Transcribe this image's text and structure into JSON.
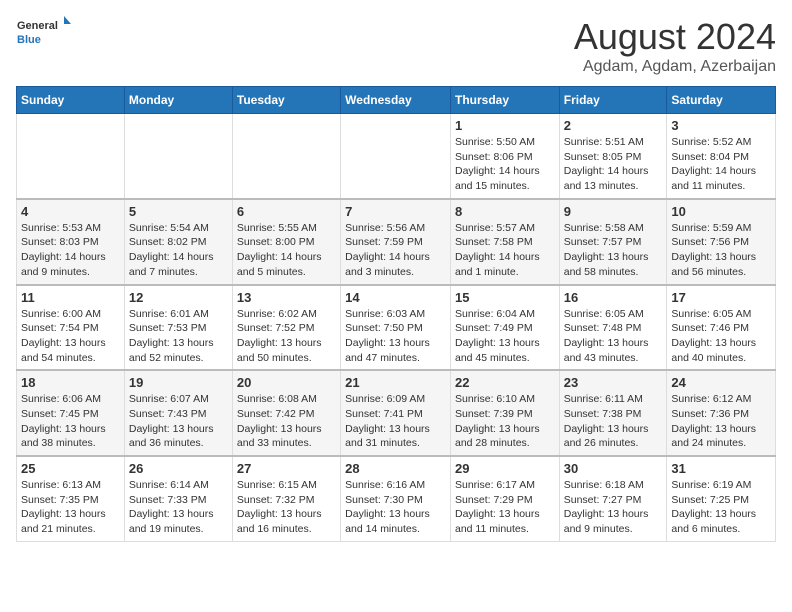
{
  "header": {
    "logo_general": "General",
    "logo_blue": "Blue",
    "month_year": "August 2024",
    "location": "Agdam, Agdam, Azerbaijan"
  },
  "weekdays": [
    "Sunday",
    "Monday",
    "Tuesday",
    "Wednesday",
    "Thursday",
    "Friday",
    "Saturday"
  ],
  "weeks": [
    [
      {
        "day": "",
        "detail": ""
      },
      {
        "day": "",
        "detail": ""
      },
      {
        "day": "",
        "detail": ""
      },
      {
        "day": "",
        "detail": ""
      },
      {
        "day": "1",
        "detail": "Sunrise: 5:50 AM\nSunset: 8:06 PM\nDaylight: 14 hours and 15 minutes."
      },
      {
        "day": "2",
        "detail": "Sunrise: 5:51 AM\nSunset: 8:05 PM\nDaylight: 14 hours and 13 minutes."
      },
      {
        "day": "3",
        "detail": "Sunrise: 5:52 AM\nSunset: 8:04 PM\nDaylight: 14 hours and 11 minutes."
      }
    ],
    [
      {
        "day": "4",
        "detail": "Sunrise: 5:53 AM\nSunset: 8:03 PM\nDaylight: 14 hours and 9 minutes."
      },
      {
        "day": "5",
        "detail": "Sunrise: 5:54 AM\nSunset: 8:02 PM\nDaylight: 14 hours and 7 minutes."
      },
      {
        "day": "6",
        "detail": "Sunrise: 5:55 AM\nSunset: 8:00 PM\nDaylight: 14 hours and 5 minutes."
      },
      {
        "day": "7",
        "detail": "Sunrise: 5:56 AM\nSunset: 7:59 PM\nDaylight: 14 hours and 3 minutes."
      },
      {
        "day": "8",
        "detail": "Sunrise: 5:57 AM\nSunset: 7:58 PM\nDaylight: 14 hours and 1 minute."
      },
      {
        "day": "9",
        "detail": "Sunrise: 5:58 AM\nSunset: 7:57 PM\nDaylight: 13 hours and 58 minutes."
      },
      {
        "day": "10",
        "detail": "Sunrise: 5:59 AM\nSunset: 7:56 PM\nDaylight: 13 hours and 56 minutes."
      }
    ],
    [
      {
        "day": "11",
        "detail": "Sunrise: 6:00 AM\nSunset: 7:54 PM\nDaylight: 13 hours and 54 minutes."
      },
      {
        "day": "12",
        "detail": "Sunrise: 6:01 AM\nSunset: 7:53 PM\nDaylight: 13 hours and 52 minutes."
      },
      {
        "day": "13",
        "detail": "Sunrise: 6:02 AM\nSunset: 7:52 PM\nDaylight: 13 hours and 50 minutes."
      },
      {
        "day": "14",
        "detail": "Sunrise: 6:03 AM\nSunset: 7:50 PM\nDaylight: 13 hours and 47 minutes."
      },
      {
        "day": "15",
        "detail": "Sunrise: 6:04 AM\nSunset: 7:49 PM\nDaylight: 13 hours and 45 minutes."
      },
      {
        "day": "16",
        "detail": "Sunrise: 6:05 AM\nSunset: 7:48 PM\nDaylight: 13 hours and 43 minutes."
      },
      {
        "day": "17",
        "detail": "Sunrise: 6:05 AM\nSunset: 7:46 PM\nDaylight: 13 hours and 40 minutes."
      }
    ],
    [
      {
        "day": "18",
        "detail": "Sunrise: 6:06 AM\nSunset: 7:45 PM\nDaylight: 13 hours and 38 minutes."
      },
      {
        "day": "19",
        "detail": "Sunrise: 6:07 AM\nSunset: 7:43 PM\nDaylight: 13 hours and 36 minutes."
      },
      {
        "day": "20",
        "detail": "Sunrise: 6:08 AM\nSunset: 7:42 PM\nDaylight: 13 hours and 33 minutes."
      },
      {
        "day": "21",
        "detail": "Sunrise: 6:09 AM\nSunset: 7:41 PM\nDaylight: 13 hours and 31 minutes."
      },
      {
        "day": "22",
        "detail": "Sunrise: 6:10 AM\nSunset: 7:39 PM\nDaylight: 13 hours and 28 minutes."
      },
      {
        "day": "23",
        "detail": "Sunrise: 6:11 AM\nSunset: 7:38 PM\nDaylight: 13 hours and 26 minutes."
      },
      {
        "day": "24",
        "detail": "Sunrise: 6:12 AM\nSunset: 7:36 PM\nDaylight: 13 hours and 24 minutes."
      }
    ],
    [
      {
        "day": "25",
        "detail": "Sunrise: 6:13 AM\nSunset: 7:35 PM\nDaylight: 13 hours and 21 minutes."
      },
      {
        "day": "26",
        "detail": "Sunrise: 6:14 AM\nSunset: 7:33 PM\nDaylight: 13 hours and 19 minutes."
      },
      {
        "day": "27",
        "detail": "Sunrise: 6:15 AM\nSunset: 7:32 PM\nDaylight: 13 hours and 16 minutes."
      },
      {
        "day": "28",
        "detail": "Sunrise: 6:16 AM\nSunset: 7:30 PM\nDaylight: 13 hours and 14 minutes."
      },
      {
        "day": "29",
        "detail": "Sunrise: 6:17 AM\nSunset: 7:29 PM\nDaylight: 13 hours and 11 minutes."
      },
      {
        "day": "30",
        "detail": "Sunrise: 6:18 AM\nSunset: 7:27 PM\nDaylight: 13 hours and 9 minutes."
      },
      {
        "day": "31",
        "detail": "Sunrise: 6:19 AM\nSunset: 7:25 PM\nDaylight: 13 hours and 6 minutes."
      }
    ]
  ]
}
